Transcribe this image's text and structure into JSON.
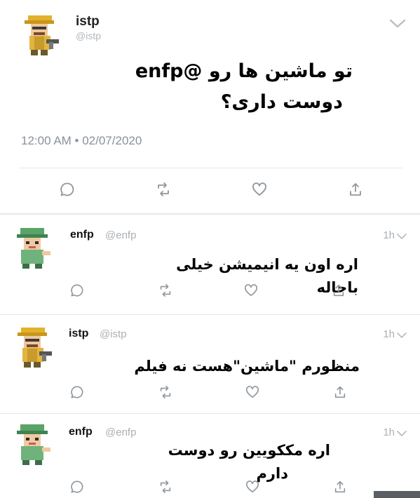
{
  "main_tweet": {
    "name": "istp",
    "handle": "@istp",
    "text_line1": "تو ماشین ها رو @enfp",
    "text_line2": "دوست داری؟",
    "timestamp": "12:00 AM • 02/07/2020",
    "actions": [
      "reply-icon",
      "retweet-icon",
      "like-icon",
      "share-icon"
    ]
  },
  "replies": [
    {
      "name": "enfp",
      "handle": "@enfp",
      "time": "1h",
      "text_line1": "اره اون یه انیمیشن خیلی",
      "text_line2": "باحاله"
    },
    {
      "name": "istp",
      "handle": "@istp",
      "time": "1h",
      "text_line1": "منظورم \"ماشین\"هست نه فیلم",
      "text_line2": ""
    },
    {
      "name": "enfp",
      "handle": "@enfp",
      "time": "1h",
      "text_line1": "اره مککویین رو دوست",
      "text_line2": "دارم"
    }
  ],
  "colors": {
    "icon_gray": "#8f979e",
    "divider": "#e3e6e9",
    "istp_hat": "#e0b020",
    "enfp_hat": "#4a8f55"
  }
}
